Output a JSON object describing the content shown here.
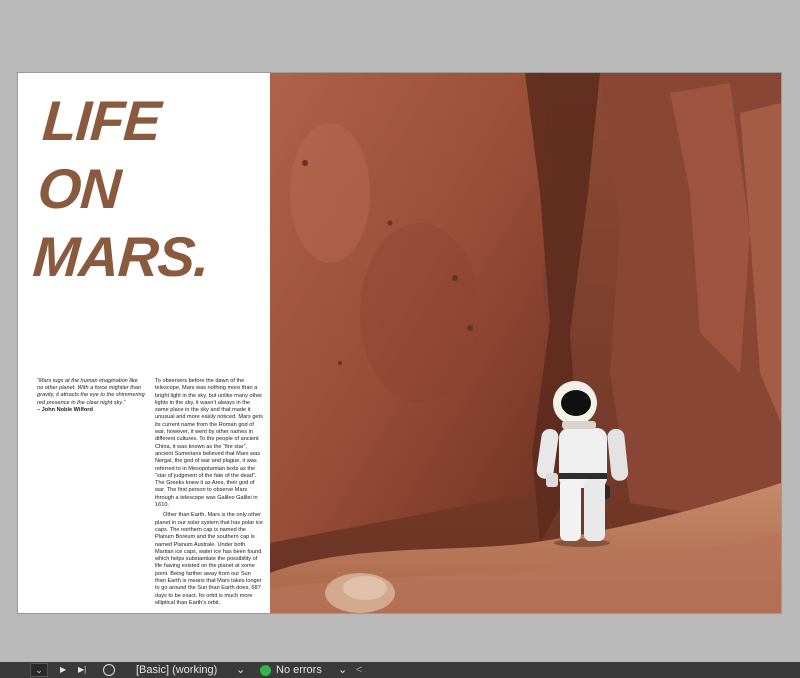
{
  "document": {
    "headline": [
      "LIFE",
      "ON",
      "MARS."
    ],
    "quote": {
      "text": "“Mars tugs at the human imagination like no other planet. With a force mightier than gravity, it attracts the eye to the shimmering red presence in the clear night sky.”",
      "author": "– John Noble Wilford"
    },
    "body": [
      "To observers before the dawn of the telescope, Mars was nothing more than a bright light in the sky, but unlike many other lights in the sky, it wasn’t always in the same place in the sky and that made it unusual and more easily noticed. Mars gets its current name from the Roman god of war, however, it went by other names in different cultures. To the people of ancient China, it was known as the “fire star”, ancient Sumerians believed that Mars was Nergal, the god of war and plague, it was referred to in Mesopotamian texts as the “star of judgment of the fate of the dead”. The Greeks knew it as Ares, their god of war. The first person to observe Mars through a telescope was Galileo Galilei in 1610.",
      "Other than Earth, Mars is the only other planet in our solar system that has polar ice caps. The northern cap is named the Planum Boreum and the southern cap is named Planum Australe. Under both Martian ice caps, water ice has been found which helps substantiate the possibility of life having existed on the planet at some point. Being farther away from our Sun than Earth is means that Mars takes longer to go around the Sun than Earth does, 687 days to be exact. Its orbit is much more elliptical than Earth’s orbit."
    ]
  },
  "statusbar": {
    "page_chevron": "⌄",
    "next": "▶",
    "last": "▶|",
    "style": "[Basic] (working)",
    "style_chevron": "⌄",
    "preflight": "No errors",
    "preflight_chevron": "⌄",
    "collapse": "<"
  },
  "colors": {
    "headline": "#8a5a3e",
    "preflight_ok": "#38b44a",
    "pasteboard": "#b9b9b9"
  }
}
